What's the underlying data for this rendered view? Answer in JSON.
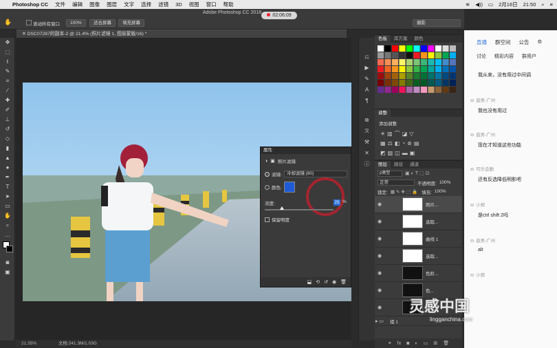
{
  "menubar": {
    "app": "Photoshop CC",
    "items": [
      "文件",
      "编辑",
      "图像",
      "图层",
      "文字",
      "选择",
      "滤镜",
      "3D",
      "视图",
      "窗口",
      "帮助"
    ],
    "date": "2月16日",
    "time": "21:50"
  },
  "window": {
    "title": "Adobe Photoshop CC 2018",
    "recording_time": "02:06:09"
  },
  "options": {
    "scroll_all_label": "滚动所有窗口",
    "zoom_label": "100%",
    "fit_screen_label": "适合屏幕",
    "fill_screen_label": "填充屏幕",
    "workspace": "摄影"
  },
  "document": {
    "tab": "DSC07287的副本-2 @ 21.4% (照片滤镜 1, 图层蒙版/16) *",
    "zoom": "21.35%",
    "doc_info": "文档:241.3M/1.03G"
  },
  "swatches_panel": {
    "tabs": [
      "色板",
      "库方案",
      "颜色"
    ]
  },
  "adjust_panel": {
    "tabs": [
      "调整"
    ],
    "add_label": "添加调整"
  },
  "layers_panel": {
    "tabs": [
      "图层",
      "路径",
      "通道"
    ],
    "kind_label": "ρ类型",
    "blend_mode": "正常",
    "opacity_label": "不透明度:",
    "opacity": "100%",
    "lock_label": "锁定:",
    "fill_label": "填充:",
    "fill": "100%",
    "layers": [
      {
        "name": "照片...",
        "type": "adjust"
      },
      {
        "name": "选取...",
        "type": "adjust"
      },
      {
        "name": "曲线 1",
        "type": "adjust"
      },
      {
        "name": "选取...",
        "type": "adjust"
      },
      {
        "name": "色阶...",
        "type": "adjust"
      },
      {
        "name": "色...",
        "type": "adjust"
      },
      {
        "name": "色...",
        "type": "adjust"
      }
    ],
    "group_name": "组 1"
  },
  "properties": {
    "title": "属性",
    "header": "照片滤镜",
    "filter_label": "滤镜:",
    "filter_value": "冷却滤镜 (80)",
    "color_label": "颜色:",
    "color": "#1f5bd6",
    "density_label": "浓度:",
    "density": "25",
    "density_unit": "%",
    "density_fraction": 0.25,
    "preserve_label": "保留明度"
  },
  "chat": {
    "tabs": [
      "直播",
      "群空间",
      "公告"
    ],
    "subtabs": [
      "讨论",
      "精彩内容",
      "群用户"
    ],
    "messages": [
      {
        "name": "",
        "text": "我从来，没有用过中间调"
      },
      {
        "name": "直男-广州",
        "text": "我也没有用过"
      },
      {
        "name": "直男-广州",
        "text": "现在才知道这些功能"
      },
      {
        "name": "可乐会勤",
        "text": "还有反选降低明影吧"
      },
      {
        "name": "小郑",
        "text": "是ctrl shift 2吗"
      },
      {
        "name": "直男-广州",
        "text": "alt"
      },
      {
        "name": "小郑",
        "text": ""
      }
    ],
    "watermark": "灵感中国",
    "watermark_sub": "lingganchina.com"
  },
  "colors": {
    "chat_accent": "#3a7be0",
    "record_red": "#e22b3b"
  }
}
